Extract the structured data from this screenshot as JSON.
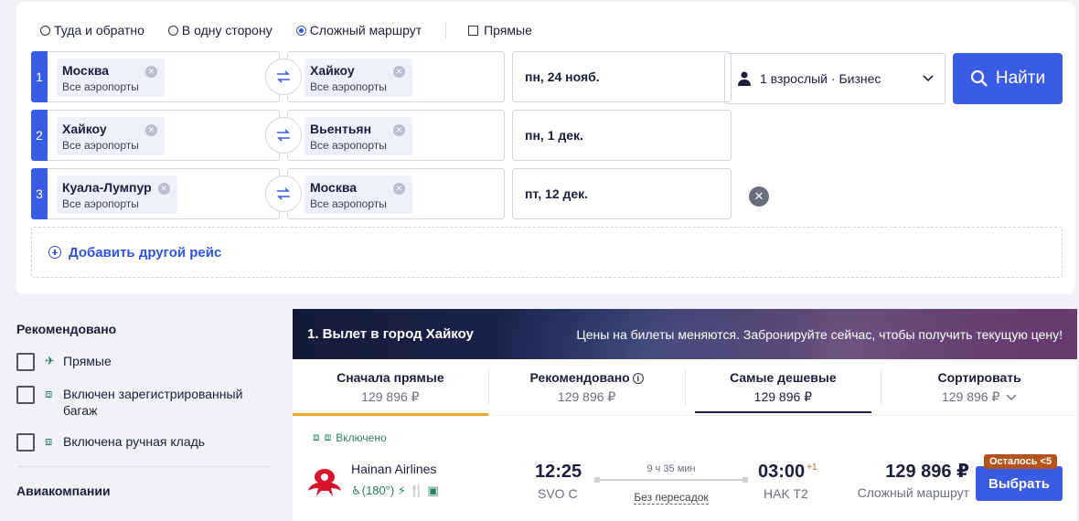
{
  "trip_types": [
    {
      "label": "Туда и обратно",
      "checked": false
    },
    {
      "label": "В одну сторону",
      "checked": false
    },
    {
      "label": "Сложный маршрут",
      "checked": true
    }
  ],
  "direct_label": "Прямые",
  "legs": [
    {
      "num": "1",
      "from_city": "Москва",
      "from_sub": "Все аэропорты",
      "to_city": "Хайкоу",
      "to_sub": "Все аэропорты",
      "date": "пн, 24 нояб."
    },
    {
      "num": "2",
      "from_city": "Хайкоу",
      "from_sub": "Все аэропорты",
      "to_city": "Вьентьян",
      "to_sub": "Все аэропорты",
      "date": "пн, 1 дек."
    },
    {
      "num": "3",
      "from_city": "Куала-Лумпур",
      "from_sub": "Все аэропорты",
      "to_city": "Москва",
      "to_sub": "Все аэропорты",
      "date": "пт, 12 дек."
    }
  ],
  "passengers": "1 взрослый · Бизнес",
  "search_button": "Найти",
  "add_flight": "Добавить другой рейс",
  "filters": {
    "recommended_title": "Рекомендовано",
    "items": [
      {
        "label": "Прямые",
        "icon": "plane-icon"
      },
      {
        "label": "Включен зарегистрированный багаж",
        "icon": "suitcase-icon"
      },
      {
        "label": "Включена ручная кладь",
        "icon": "bag-icon"
      }
    ],
    "airlines_title": "Авиакомпании"
  },
  "results": {
    "banner_title": "1. Вылет в город Хайкоу",
    "banner_note": "Цены на билеты меняются. Забронируйте сейчас, чтобы получить текущую цену!",
    "tabs": [
      {
        "label": "Сначала прямые",
        "price": "129 896 ₽"
      },
      {
        "label": "Рекомендовано",
        "price": "129 896 ₽"
      },
      {
        "label": "Самые дешевые",
        "price": "129 896 ₽"
      },
      {
        "label": "Сортировать",
        "price": "129 896 ₽"
      }
    ],
    "ticket": {
      "included": "Включено",
      "airline": "Hainan Airlines",
      "amenities": "(180°)",
      "dep_time": "12:25",
      "dep_airport": "SVO C",
      "duration": "9 ч 35 мин",
      "stops": "Без пересадок",
      "arr_time": "03:00",
      "arr_offset": "+1",
      "arr_airport": "HAK T2",
      "price": "129 896 ₽",
      "price_note": "Сложный маршрут",
      "seats_left": "Осталось <5",
      "select_button": "Выбрать"
    }
  },
  "colors": {
    "accent": "#3a5be4",
    "active_tab": "#f2a623",
    "badge": "#b4541c",
    "green": "#2a7f62"
  }
}
